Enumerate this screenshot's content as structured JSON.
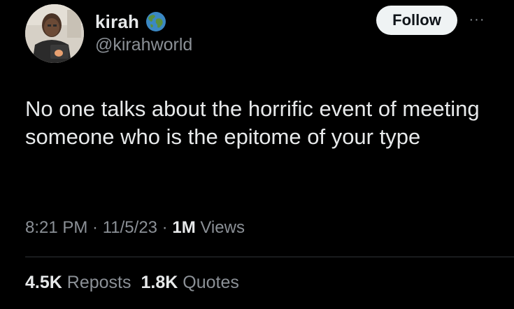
{
  "author": {
    "display_name": "kirah",
    "handle": "@kirahworld",
    "avatar": "avatar-photo",
    "badge_icon": "globe-emoji-icon"
  },
  "actions": {
    "follow_label": "Follow",
    "more_label": "···"
  },
  "tweet": {
    "text": "No one talks about the horrific event of meeting someone who is the epitome of your type"
  },
  "meta": {
    "time": "8:21 PM",
    "sep1": " · ",
    "date": "11/5/23",
    "sep2": " · ",
    "views_count": "1M",
    "views_label": " Views"
  },
  "stats": {
    "reposts_count": "4.5K",
    "reposts_label": " Reposts",
    "quotes_count": "1.8K",
    "quotes_label": " Quotes"
  },
  "colors": {
    "background": "#000000",
    "primary_text": "#e7e9ea",
    "secondary_text": "#8b9096",
    "follow_bg": "#eff3f4",
    "divider": "#2f3336"
  }
}
